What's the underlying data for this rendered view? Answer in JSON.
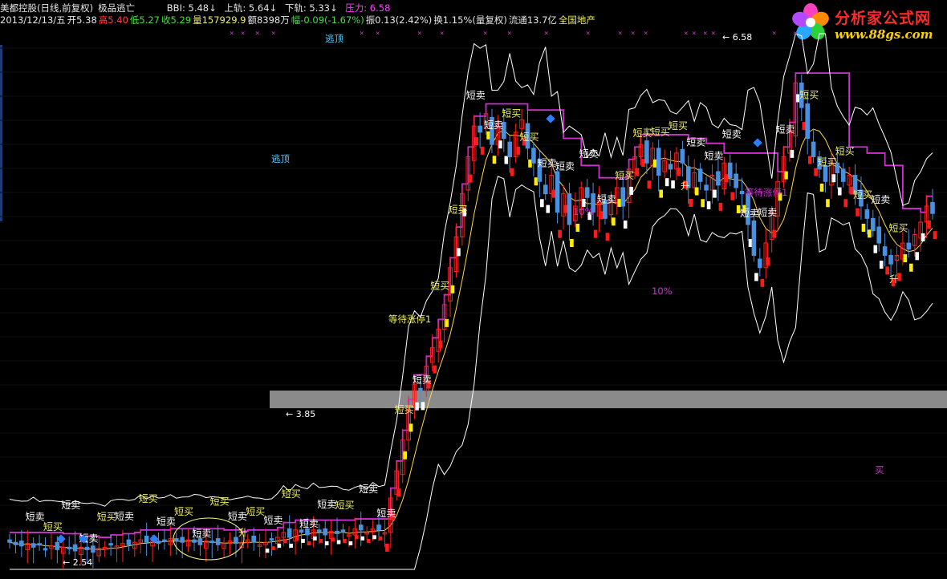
{
  "header": {
    "stock_title": "美都控股(日线,前复权)",
    "indicator_name": "极品逃亡",
    "bbi": "BBI: 5.48",
    "bbi_arrow": "↓",
    "upper": "上轨: 5.64",
    "upper_arrow": "↓",
    "lower": "下轨: 5.33",
    "lower_arrow": "↓",
    "pressure": "压力: 6.58",
    "date": "2013/12/13/五",
    "open": "开5.38",
    "high": "高5.40",
    "low": "低5.27",
    "close": "收5.29",
    "volume": "量157929.9",
    "amount": "额8398万",
    "change": "幅-0.09(-1.67%)",
    "amplitude": "振0.13(2.42%)",
    "turnover": "换1.15%(量复权)",
    "float_cap": "流通13.7亿",
    "sector": "全国地产"
  },
  "logo": {
    "title": "分析家公式网",
    "url": "www.88gs.com"
  },
  "colors": {
    "background": "#000000",
    "up_candle": "#ff2020",
    "down_candle": "#4a90e0",
    "pressure_line": "#d030d0",
    "band_line": "#ffffff",
    "label_white": "#ffffff",
    "label_yellow": "#f0f060",
    "label_magenta": "#d030d0",
    "gray_band": "#8a8a8a"
  },
  "chart_data": {
    "type": "candlestick",
    "title": "",
    "price_annotations": [
      {
        "text": "6.58",
        "value": 6.58
      },
      {
        "text": "3.85",
        "value": 3.85
      },
      {
        "text": "2.54",
        "value": 2.54
      }
    ],
    "annotations": [
      {
        "text": "逃顶",
        "color": "cyan"
      },
      {
        "text": "逃顶",
        "color": "cyan"
      },
      {
        "text": "等待涨停1",
        "color": "yellow"
      },
      {
        "text": "等待涨停1",
        "color": "magenta"
      },
      {
        "text": "10%",
        "color": "magenta"
      },
      {
        "text": "10%",
        "color": "magenta"
      },
      {
        "text": "升",
        "color": "yellow"
      },
      {
        "text": "升",
        "color": "yellow"
      },
      {
        "text": "升",
        "color": "yellow"
      },
      {
        "text": "买",
        "color": "magenta"
      }
    ],
    "signal_labels": [
      {
        "text": "短卖",
        "color": "white"
      },
      {
        "text": "短买",
        "color": "yellow"
      },
      {
        "text": "短卖",
        "color": "white"
      },
      {
        "text": "短卖",
        "color": "white"
      },
      {
        "text": "短买",
        "color": "yellow"
      },
      {
        "text": "短卖",
        "color": "white"
      },
      {
        "text": "短买",
        "color": "yellow"
      },
      {
        "text": "短卖",
        "color": "white"
      },
      {
        "text": "短买",
        "color": "yellow"
      },
      {
        "text": "短卖",
        "color": "white"
      },
      {
        "text": "短买",
        "color": "yellow"
      },
      {
        "text": "短卖",
        "color": "white"
      },
      {
        "text": "短买",
        "color": "yellow"
      },
      {
        "text": "短卖",
        "color": "white"
      },
      {
        "text": "短买",
        "color": "yellow"
      },
      {
        "text": "短卖",
        "color": "white"
      },
      {
        "text": "短卖",
        "color": "white"
      },
      {
        "text": "短买",
        "color": "yellow"
      },
      {
        "text": "短卖",
        "color": "white"
      },
      {
        "text": "短卖",
        "color": "white"
      },
      {
        "text": "短买",
        "color": "yellow"
      },
      {
        "text": "短卖",
        "color": "white"
      },
      {
        "text": "短买",
        "color": "yellow"
      },
      {
        "text": "短买",
        "color": "yellow"
      },
      {
        "text": "短卖",
        "color": "white"
      },
      {
        "text": "短卖",
        "color": "white"
      },
      {
        "text": "短买",
        "color": "yellow"
      },
      {
        "text": "短买",
        "color": "yellow"
      },
      {
        "text": "短卖",
        "color": "white"
      },
      {
        "text": "短卖",
        "color": "white"
      },
      {
        "text": "短卖",
        "color": "white"
      },
      {
        "text": "短卖",
        "color": "white"
      },
      {
        "text": "短买",
        "color": "yellow"
      },
      {
        "text": "短买",
        "color": "yellow"
      },
      {
        "text": "短买",
        "color": "yellow"
      },
      {
        "text": "短买",
        "color": "yellow"
      },
      {
        "text": "短卖",
        "color": "white"
      },
      {
        "text": "短卖",
        "color": "white"
      },
      {
        "text": "短卖",
        "color": "white"
      },
      {
        "text": "短卖",
        "color": "white"
      },
      {
        "text": "短卖",
        "color": "white"
      },
      {
        "text": "短卖",
        "color": "white"
      },
      {
        "text": "短买",
        "color": "yellow"
      },
      {
        "text": "短买",
        "color": "yellow"
      },
      {
        "text": "短买",
        "color": "yellow"
      },
      {
        "text": "短买",
        "color": "yellow"
      },
      {
        "text": "短卖",
        "color": "white"
      },
      {
        "text": "短买",
        "color": "yellow"
      }
    ],
    "closes": [
      2.62,
      2.6,
      2.59,
      2.61,
      2.58,
      2.6,
      2.57,
      2.59,
      2.56,
      2.58,
      2.57,
      2.55,
      2.58,
      2.56,
      2.54,
      2.57,
      2.58,
      2.6,
      2.59,
      2.61,
      2.6,
      2.62,
      2.64,
      2.62,
      2.63,
      2.61,
      2.63,
      2.65,
      2.63,
      2.62,
      2.64,
      2.62,
      2.6,
      2.63,
      2.62,
      2.6,
      2.61,
      2.63,
      2.61,
      2.62,
      2.64,
      2.62,
      2.6,
      2.62,
      2.64,
      2.66,
      2.7,
      2.66,
      2.72,
      2.7,
      2.68,
      2.72,
      2.7,
      2.68,
      2.71,
      2.69,
      2.7,
      2.68,
      2.73,
      2.72,
      2.7,
      2.73,
      2.72,
      2.7,
      2.98,
      3.2,
      3.45,
      3.7,
      3.9,
      3.85,
      4.05,
      4.2,
      4.35,
      4.55,
      4.85,
      5.1,
      5.45,
      5.75,
      6.0,
      5.95,
      6.1,
      5.85,
      6.0,
      5.9,
      5.75,
      5.95,
      6.05,
      5.82,
      5.7,
      5.55,
      5.45,
      5.6,
      5.3,
      5.45,
      5.2,
      5.35,
      5.5,
      5.42,
      5.3,
      5.4,
      5.25,
      5.4,
      5.5,
      5.35,
      5.65,
      5.75,
      5.85,
      5.7,
      5.82,
      5.6,
      5.72,
      5.65,
      5.78,
      5.7,
      5.5,
      5.62,
      5.55,
      5.48,
      5.6,
      5.52,
      5.7,
      5.58,
      5.5,
      5.45,
      5.2,
      4.95,
      4.85,
      5.05,
      5.3,
      5.55,
      5.75,
      5.95,
      6.35,
      6.15,
      5.9,
      5.75,
      5.65,
      5.55,
      5.7,
      5.62,
      5.55,
      5.6,
      5.45,
      5.35,
      5.25,
      5.15,
      5.05,
      4.95,
      4.88,
      4.95,
      5.05,
      5.0,
      5.12,
      5.22,
      5.35,
      5.29
    ]
  }
}
